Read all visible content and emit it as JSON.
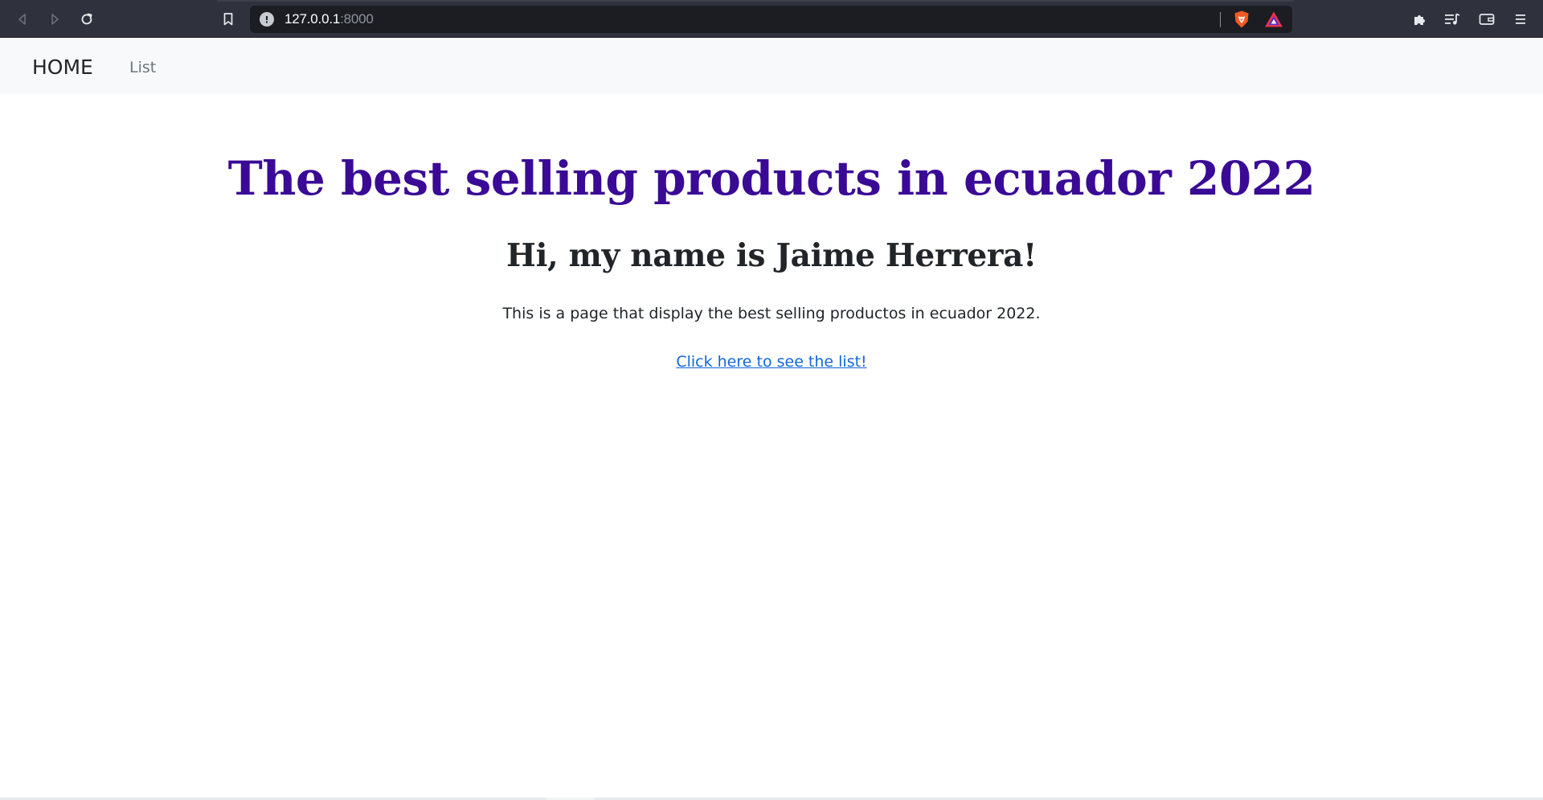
{
  "browser": {
    "url_host": "127.0.0.1",
    "url_port": ":8000",
    "icons": {
      "back": "back-arrow-icon",
      "forward": "forward-arrow-icon",
      "reload": "reload-icon",
      "bookmark": "bookmark-icon",
      "site_info": "info-icon",
      "brave_shield": "brave-shield-icon",
      "rewards": "brave-rewards-icon",
      "extensions": "puzzle-icon",
      "playlist": "playlist-icon",
      "wallet": "wallet-icon",
      "menu": "hamburger-menu-icon"
    }
  },
  "navbar": {
    "brand": "HOME",
    "links": [
      {
        "label": "List"
      }
    ]
  },
  "main": {
    "title": "The best selling products in ecuador 2022",
    "subtitle": "Hi, my name is Jaime Herrera!",
    "description": "This is a page that display the best selling productos in ecuador 2022.",
    "link_text": "Click here to see the list!"
  },
  "colors": {
    "title": "#3a0a96",
    "link": "#1466d8",
    "navbar_bg": "#f8f9fa",
    "chrome_bg": "#2f323c"
  }
}
